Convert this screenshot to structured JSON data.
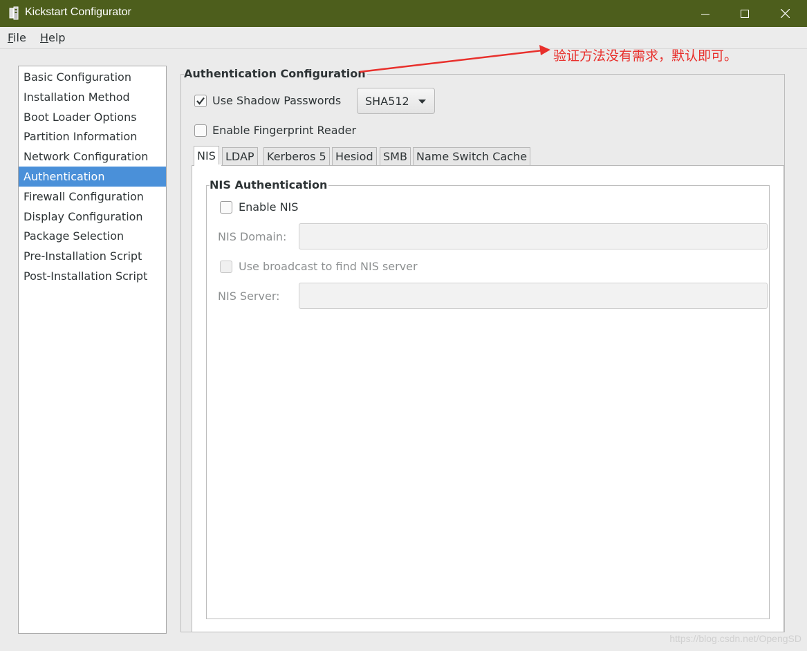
{
  "window": {
    "title": "Kickstart Configurator",
    "controls": [
      "minimize-icon",
      "maximize-icon",
      "close-icon"
    ]
  },
  "menubar": {
    "file": {
      "accel": "F",
      "rest": "ile"
    },
    "help": {
      "accel": "H",
      "rest": "elp"
    }
  },
  "sidebar": {
    "selected": "Authentication",
    "items": [
      "Basic Configuration",
      "Installation Method",
      "Boot Loader Options",
      "Partition Information",
      "Network Configuration",
      "Authentication",
      "Firewall Configuration",
      "Display Configuration",
      "Package Selection",
      "Pre-Installation Script",
      "Post-Installation Script"
    ]
  },
  "auth": {
    "frame_title": "Authentication Configuration",
    "shadow": {
      "label": "Use Shadow Passwords",
      "checked": true
    },
    "hash": {
      "value": "SHA512"
    },
    "fingerprint": {
      "label": "Enable Fingerprint Reader",
      "checked": false
    },
    "tabs": [
      "NIS",
      "LDAP",
      "Kerberos 5",
      "Hesiod",
      "SMB",
      "Name Switch Cache"
    ],
    "active_tab": "NIS"
  },
  "nis": {
    "frame_title": "NIS Authentication",
    "enable": {
      "label": "Enable NIS",
      "checked": false
    },
    "domain": {
      "label": "NIS Domain:",
      "value": ""
    },
    "broadcast": {
      "label": "Use broadcast to find NIS server",
      "checked": false
    },
    "server": {
      "label": "NIS Server:",
      "value": ""
    }
  },
  "annotation": {
    "text": "验证方法没有需求，默认即可。",
    "color": "#e8302c"
  },
  "watermark": "https://blog.csdn.net/OpengSD",
  "colors": {
    "titlebar": "#4d5e1c",
    "selection": "#4a90d9"
  }
}
